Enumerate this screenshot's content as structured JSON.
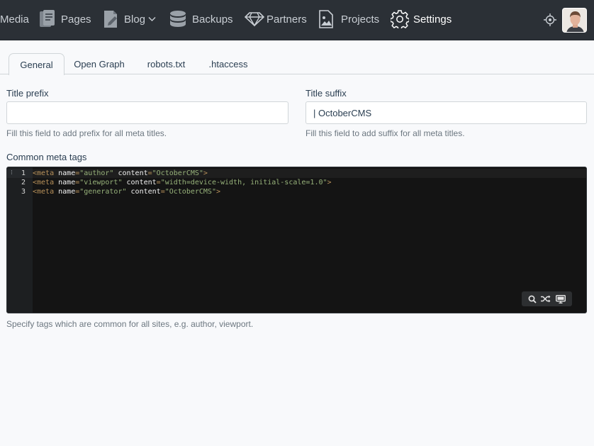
{
  "nav": {
    "items": [
      {
        "label": "Media",
        "icon": "media-icon"
      },
      {
        "label": "Pages",
        "icon": "pages-icon"
      },
      {
        "label": "Blog",
        "icon": "blog-icon"
      },
      {
        "label": "Backups",
        "icon": "database-icon"
      },
      {
        "label": "Partners",
        "icon": "diamond-icon"
      },
      {
        "label": "Projects",
        "icon": "image-icon"
      },
      {
        "label": "Settings",
        "icon": "gear-icon"
      }
    ]
  },
  "tabs": [
    {
      "label": "General"
    },
    {
      "label": "Open Graph"
    },
    {
      "label": "robots.txt"
    },
    {
      "label": ".htaccess"
    }
  ],
  "form": {
    "title_prefix": {
      "label": "Title prefix",
      "value": "",
      "help": "Fill this field to add prefix for all meta titles."
    },
    "title_suffix": {
      "label": "Title suffix",
      "value": "| OctoberCMS",
      "help": "Fill this field to add suffix for all meta titles."
    },
    "meta_tags": {
      "label": "Common meta tags",
      "help": "Specify tags which are common for all sites, e.g. author, viewport.",
      "lines": [
        {
          "num": "1",
          "attr1": "name",
          "val1": "\"author\"",
          "attr2": "content",
          "val2": "\"OctoberCMS\""
        },
        {
          "num": "2",
          "attr1": "name",
          "val1": "\"viewport\"",
          "attr2": "content",
          "val2": "\"width=device-width, initial-scale=1.0\""
        },
        {
          "num": "3",
          "attr1": "name",
          "val1": "\"generator\"",
          "attr2": "content",
          "val2": "\"OctoberCMS\""
        }
      ]
    }
  },
  "colors": {
    "nav_bg": "#2b3036",
    "editor_bg": "#141414",
    "tag": "#b8915a",
    "string": "#97b27a"
  }
}
